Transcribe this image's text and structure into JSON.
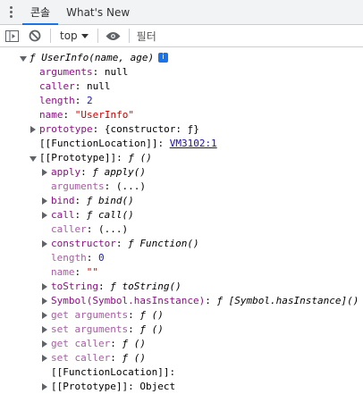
{
  "tabs": [
    {
      "label": "콘솔",
      "active": true
    },
    {
      "label": "What's New",
      "active": false
    }
  ],
  "toolbar": {
    "context": "top",
    "filter_placeholder": "필터"
  },
  "console": {
    "head": "ƒ UserInfo(name, age)",
    "info_badge": "i",
    "arguments_key": "arguments",
    "arguments_val": "null",
    "caller_key": "caller",
    "caller_val": "null",
    "length_key": "length",
    "length_val": "2",
    "name_key": "name",
    "name_val": "\"UserInfo\"",
    "prototype_key": "prototype",
    "prototype_val": "{constructor: ƒ}",
    "fl_key": "[[FunctionLocation]]",
    "fl_link": "VM3102:1",
    "proto_key": "[[Prototype]]",
    "proto_val": "ƒ ()",
    "p_apply_key": "apply",
    "p_apply_val": "ƒ apply()",
    "p_arguments_key": "arguments",
    "p_arguments_val": "(...)",
    "p_bind_key": "bind",
    "p_bind_val": "ƒ bind()",
    "p_call_key": "call",
    "p_call_val": "ƒ call()",
    "p_caller_key": "caller",
    "p_caller_val": "(...)",
    "p_constructor_key": "constructor",
    "p_constructor_val": "ƒ Function()",
    "p_length_key": "length",
    "p_length_val": "0",
    "p_name_key": "name",
    "p_name_val": "\"\"",
    "p_tostring_key": "toString",
    "p_tostring_val": "ƒ toString()",
    "p_hasinstance_key": "Symbol(Symbol.hasInstance)",
    "p_hasinstance_val": "ƒ [Symbol.hasInstance]()",
    "p_get_arguments_key": "get arguments",
    "p_get_arguments_val": "ƒ ()",
    "p_set_arguments_key": "set arguments",
    "p_set_arguments_val": "ƒ ()",
    "p_get_caller_key": "get caller",
    "p_get_caller_val": "ƒ ()",
    "p_set_caller_key": "set caller",
    "p_set_caller_val": "ƒ ()",
    "p_fl_key": "[[FunctionLocation]]:",
    "p_proto_key": "[[Prototype]]",
    "p_proto_val": "Object"
  }
}
